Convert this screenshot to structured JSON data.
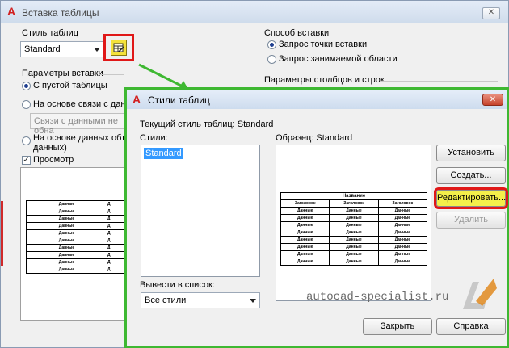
{
  "outer": {
    "title": "Вставка таблицы",
    "style_label": "Стиль таблиц",
    "style_value": "Standard",
    "insert_params_label": "Параметры вставки",
    "radio_empty": "С пустой таблицы",
    "radio_link": "На основе связи с данны",
    "link_field_text": "Связи с данными не обна",
    "radio_objects_line1": "На основе данных объект",
    "radio_objects_line2": "данных)",
    "preview_label": "Просмотр",
    "insert_mode_label": "Способ вставки",
    "radio_point": "Запрос точки вставки",
    "radio_area": "Запрос занимаемой области",
    "colrow_params_label": "Параметры столбцов и строк",
    "preview_cell": "Данные",
    "preview_cell_cut": "Д"
  },
  "inner": {
    "title": "Стили таблиц",
    "current_style": "Текущий стиль таблиц: Standard",
    "styles_label": "Стили:",
    "styles": [
      "Standard"
    ],
    "sample_label": "Образец: Standard",
    "list_filter_label": "Вывести в список:",
    "list_filter_value": "Все стили",
    "btn_set": "Установить",
    "btn_create": "Создать...",
    "btn_edit": "Редактировать...",
    "btn_delete": "Удалить",
    "btn_close": "Закрыть",
    "btn_help": "Справка",
    "sample_title": "Название",
    "sample_header": "Заголовок",
    "sample_cell": "Данные"
  },
  "watermark": "autocad-specialist.ru",
  "colors": {
    "red_highlight": "#e01818",
    "green_frame": "#3eb832",
    "selection": "#3399ff",
    "yellow_button": "#f4ef4a"
  },
  "icons": [
    "autocad-logo-icon",
    "table-style-icon",
    "close-icon",
    "dropdown-arrow-icon",
    "pointer-arrow-icon"
  ]
}
